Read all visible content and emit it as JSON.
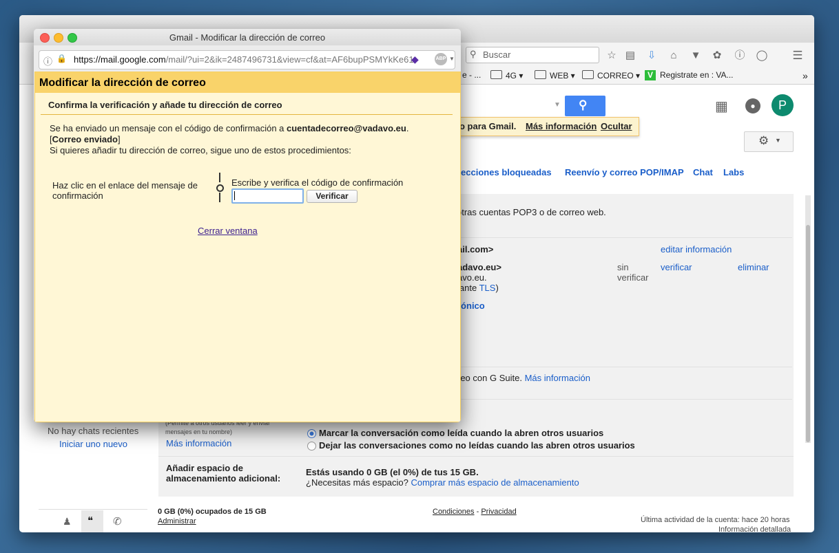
{
  "browser": {
    "search_placeholder": "Buscar",
    "bookmarks": [
      "e - ...",
      "4G",
      "WEB",
      "CORREO",
      "Registrate en : VA..."
    ]
  },
  "gmail": {
    "notice_text": "o para Gmail.",
    "notice_more": "Más información",
    "notice_hide": "Ocultar",
    "avatar_letter": "P",
    "tabs": [
      "recciones bloqueadas",
      "Reenvío y correo POP/IMAP",
      "Chat",
      "Labs"
    ],
    "row1": "otras cuentas POP3 o de correo web.",
    "acc1": "ail.com>",
    "acc1_edit": "editar información",
    "acc2": "adavo.eu>",
    "acc2_line2": "avo.eu.",
    "acc2_line3": "iante",
    "acc2_tls": "TLS",
    "acc2_close": ")",
    "acc2_status": "sin verificar",
    "acc2_verify": "verificar",
    "acc2_delete": "eliminar",
    "electronic": "rónico",
    "gsuite_text": "reo con G Suite.",
    "gsuite_more": "Más información",
    "delegation_small": "(Permite a otros usuarios leer y enviar mensajes en tu nombre)",
    "delegation_more": "Más información",
    "radio1": "Marcar la conversación como leída cuando la abren otros usuarios",
    "radio2": "Dejar las conversaciones como no leídas cuando las abren otros usuarios",
    "storage_label": "Añadir espacio de almacenamiento adicional:",
    "storage_value": "Estás usando 0 GB (el 0%) de tus 15 GB.",
    "storage_question": "¿Necesitas más espacio?",
    "storage_buy": "Comprar más espacio de almacenamiento",
    "chats_none": "No hay chats recientes",
    "chats_start": "Iniciar uno nuevo",
    "footer_used": "0 GB (0%) ocupados de 15 GB",
    "footer_manage": "Administrar",
    "footer_terms": "Condiciones",
    "footer_dash": "-",
    "footer_privacy": "Privacidad",
    "footer_activity": "Última actividad de la cuenta: hace 20 horas",
    "footer_details": "Información detallada"
  },
  "popup": {
    "window_title": "Gmail - Modificar la dirección de correo",
    "url_host": "https://mail.google.com",
    "url_rest": "/mail/?ui=2&ik=2487496731&view=cf&at=AF6bupPSMYkKe61",
    "heading": "Modificar la dirección de correo",
    "subheading": "Confirma la verificación y añade tu dirección de correo",
    "sent_prefix": "Se ha enviado un mensaje con el código de confirmación a",
    "email": "cuentadecorreo@vadavo.eu",
    "sent_suffix": ".",
    "bracket_open": "[",
    "sent_status": "Correo enviado",
    "bracket_close": "]",
    "instructions": "Si quieres añadir tu dirección de correo, sigue uno de estos procedimientos:",
    "option_link": "Haz clic en el enlace del mensaje de confirmación",
    "option_code": "Escribe y verifica el código de confirmación",
    "verify_button": "Verificar",
    "close_link": "Cerrar ventana"
  }
}
